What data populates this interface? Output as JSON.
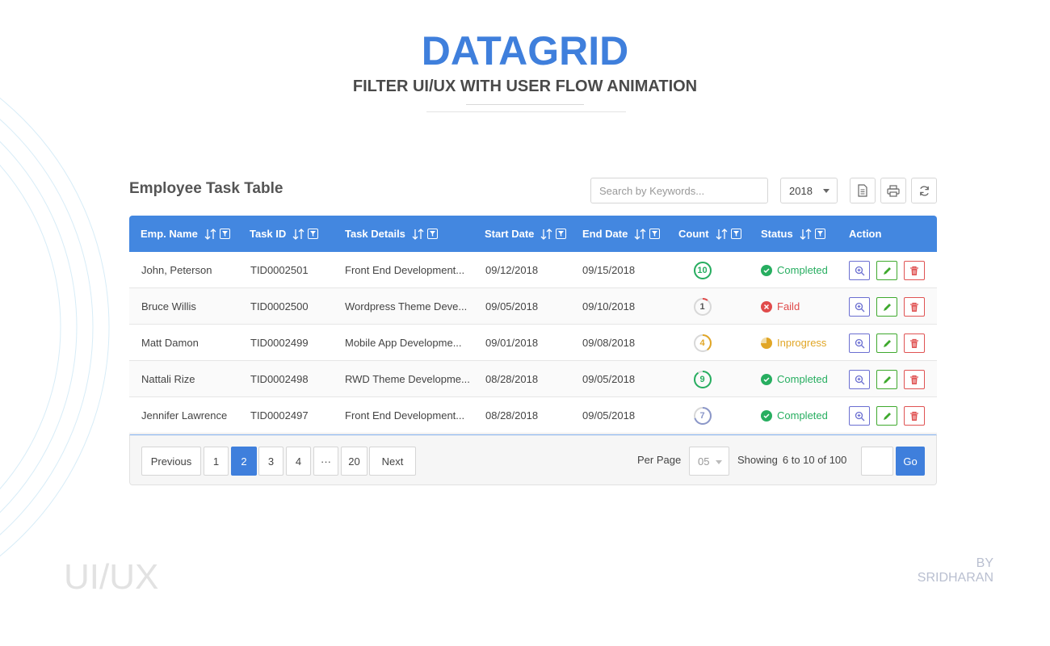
{
  "hero": {
    "title": "DATAGRID",
    "subtitle": "FILTER UI/UX WITH USER FLOW ANIMATION"
  },
  "toolbar": {
    "table_title": "Employee Task Table",
    "search_placeholder": "Search by Keywords...",
    "year": "2018",
    "icons": [
      "document-icon",
      "print-icon",
      "refresh-icon"
    ]
  },
  "columns": [
    "Emp. Name",
    "Task ID",
    "Task Details",
    "Start Date",
    "End Date",
    "Count",
    "Status",
    "Action"
  ],
  "rows": [
    {
      "name": "John, Peterson",
      "task_id": "TID0002501",
      "details": "Front End Development...",
      "start": "09/12/2018",
      "end": "09/15/2018",
      "count": "10",
      "count_progress": 1.0,
      "status": "Completed",
      "status_kind": "completed"
    },
    {
      "name": "Bruce Willis",
      "task_id": "TID0002500",
      "details": "Wordpress Theme Deve...",
      "start": "09/05/2018",
      "end": "09/10/2018",
      "count": "1",
      "count_progress": 0.1,
      "status": "Faild",
      "status_kind": "failed"
    },
    {
      "name": "Matt Damon",
      "task_id": "TID0002499",
      "details": "Mobile App Developme...",
      "start": "09/01/2018",
      "end": "09/08/2018",
      "count": "4",
      "count_progress": 0.4,
      "status": "Inprogress",
      "status_kind": "inprogress"
    },
    {
      "name": "Nattali Rize",
      "task_id": "TID0002498",
      "details": "RWD Theme Developme...",
      "start": "08/28/2018",
      "end": "09/05/2018",
      "count": "9",
      "count_progress": 0.9,
      "status": "Completed",
      "status_kind": "completed"
    },
    {
      "name": "Jennifer Lawrence",
      "task_id": "TID0002497",
      "details": "Front End Development...",
      "start": "08/28/2018",
      "end": "09/05/2018",
      "count": "7",
      "count_progress": 0.7,
      "status": "Completed",
      "status_kind": "completed"
    }
  ],
  "colors": {
    "accent": "#3f7fdc",
    "header": "#4387e0",
    "completed": "#27ae60",
    "failed": "#e04b4b",
    "inprogress": "#e1a626",
    "view": "#6b6fd1",
    "edit": "#3fa92e",
    "delete": "#e05353",
    "count_neutral": "#8b97c9"
  },
  "pagination": {
    "previous": "Previous",
    "pages": [
      "1",
      "2",
      "3",
      "4",
      "···",
      "20"
    ],
    "active_page": "2",
    "next": "Next",
    "per_page_label": "Per Page",
    "per_page_value": "05",
    "showing_label": "Showing",
    "showing_value": "6 to 10 of 100",
    "go": "Go"
  },
  "brand": {
    "left": "UI/UX",
    "by": "BY",
    "author": "SRIDHARAN"
  }
}
